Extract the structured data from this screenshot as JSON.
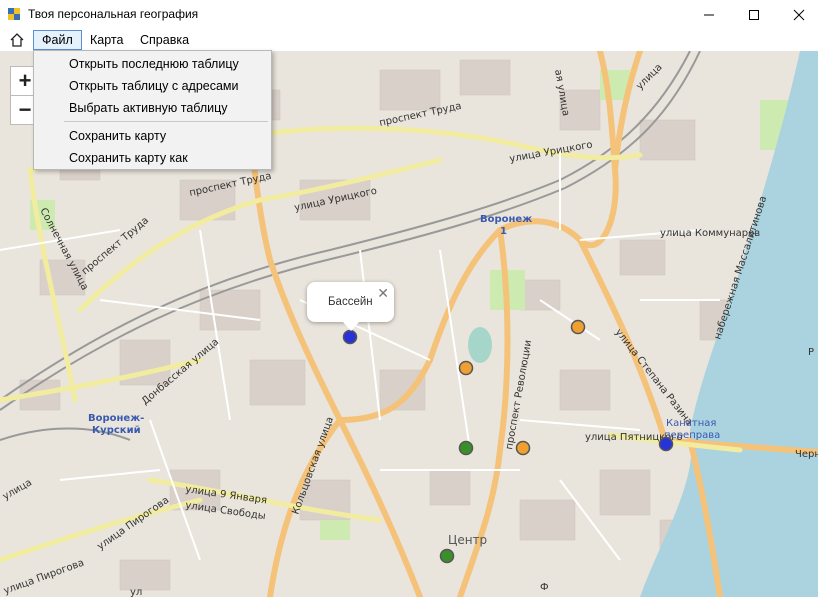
{
  "window": {
    "title": "Твоя персональная география",
    "minimize_icon": "minimize-icon",
    "maximize_icon": "maximize-icon",
    "close_icon": "close-icon"
  },
  "menubar": {
    "home_icon": "home-icon",
    "items": [
      {
        "label": "Файл",
        "active": true
      },
      {
        "label": "Карта",
        "active": false
      },
      {
        "label": "Справка",
        "active": false
      }
    ]
  },
  "file_menu": {
    "items": [
      "Открыть последнюю таблицу",
      "Открыть таблицу с адресами",
      "Выбрать активную таблицу",
      "Сохранить карту",
      "Сохранить карту как"
    ]
  },
  "zoom": {
    "in": "+",
    "out": "−"
  },
  "popup": {
    "text": "Бассейн",
    "close": "✕"
  },
  "colors": {
    "marker_blue": "#2733d8",
    "marker_orange": "#f0a030",
    "marker_green": "#3a8f2a",
    "water": "#aad3df",
    "major_road": "#f5c27a",
    "secondary_road": "#f7f3b6",
    "railway": "#999999",
    "land": "#e9e5dc",
    "park": "#cdebb0",
    "building": "#d9d0c9"
  },
  "map_labels": [
    {
      "text": "проспект Труда",
      "rotate": -12
    },
    {
      "text": "проспект Труда",
      "rotate": -12
    },
    {
      "text": "проспект Труда",
      "rotate": -40
    },
    {
      "text": "улица Урицкого",
      "rotate": -12
    },
    {
      "text": "улица Урицкого",
      "rotate": -10
    },
    {
      "text": "Солнечная улица",
      "rotate": 62
    },
    {
      "text": "Воронеж",
      "rotate": 0
    },
    {
      "text": "1",
      "rotate": 0
    },
    {
      "text": "улица Коммунаров",
      "rotate": 0
    },
    {
      "text": "набережная Массалитинова",
      "rotate": -72
    },
    {
      "text": "Донбасская улица",
      "rotate": -40
    },
    {
      "text": "Воронеж-",
      "rotate": 0
    },
    {
      "text": "Курский",
      "rotate": 0
    },
    {
      "text": "улица Пирогова",
      "rotate": -35
    },
    {
      "text": "улица 9 Января",
      "rotate": 8
    },
    {
      "text": "улица Свободы",
      "rotate": 8
    },
    {
      "text": "Кольцовская улица",
      "rotate": -70
    },
    {
      "text": "проспект Революции",
      "rotate": -80
    },
    {
      "text": "улица Степана Разина",
      "rotate": 52
    },
    {
      "text": "улица Пятницкого",
      "rotate": 0
    },
    {
      "text": "Канатная",
      "rotate": 0
    },
    {
      "text": "переправа",
      "rotate": 0
    },
    {
      "text": "Центр",
      "rotate": 0
    },
    {
      "text": "улица Пирогова",
      "rotate": -20
    },
    {
      "text": "Черн",
      "rotate": 0
    },
    {
      "text": "ая улица",
      "rotate": 0
    },
    {
      "text": "улица",
      "rotate": -45
    },
    {
      "text": "улица",
      "rotate": 0
    },
    {
      "text": "Ф",
      "rotate": 0
    },
    {
      "text": "ул",
      "rotate": 0
    },
    {
      "text": "Р",
      "rotate": 0
    }
  ],
  "markers": [
    {
      "name": "pool-marker",
      "color": "blue"
    },
    {
      "name": "marker-orange-1",
      "color": "orange"
    },
    {
      "name": "marker-orange-2",
      "color": "orange"
    },
    {
      "name": "marker-orange-3",
      "color": "orange"
    },
    {
      "name": "marker-green-1",
      "color": "green"
    },
    {
      "name": "marker-green-2",
      "color": "green"
    },
    {
      "name": "marker-blue-2",
      "color": "blue"
    }
  ]
}
